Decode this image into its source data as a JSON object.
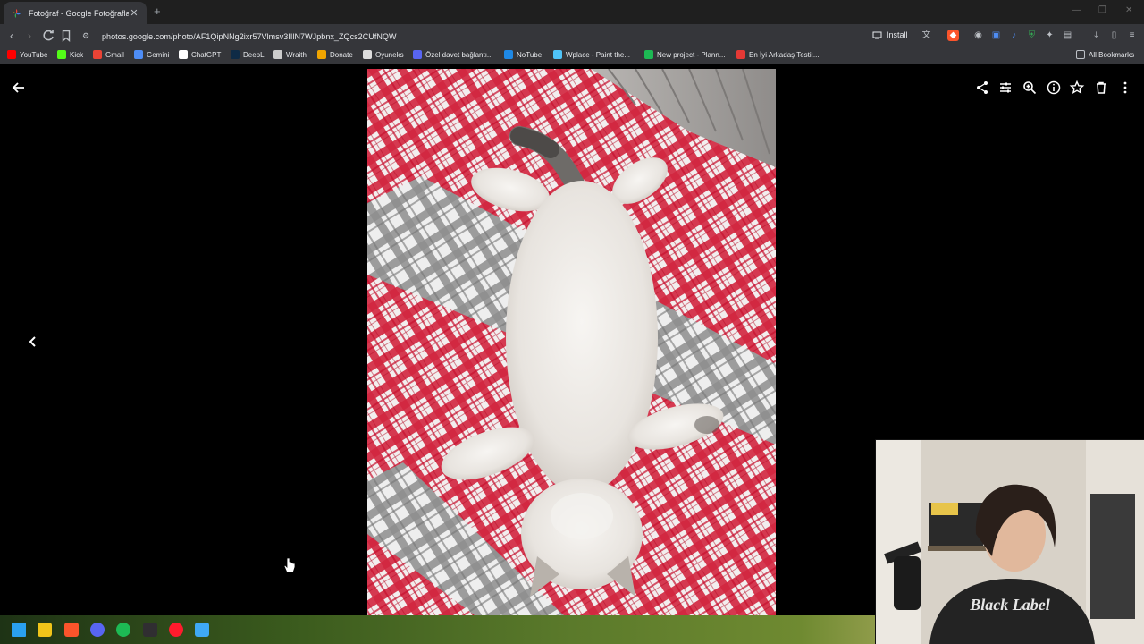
{
  "browser": {
    "tab": {
      "title": "Fotoğraf - Google Fotoğraflar",
      "close_glyph": "✕"
    },
    "new_tab_glyph": "+",
    "url": "photos.google.com/photo/AF1QipNNg2ixr57Vlmsv3IIlN7WJpbnx_ZQcs2CUfNQW",
    "install_label": "Install",
    "bookmarks": [
      {
        "label": "YouTube",
        "icon": "youtube-icon",
        "color": "#ff0000"
      },
      {
        "label": "Kick",
        "icon": "kick-icon",
        "color": "#53fc18"
      },
      {
        "label": "Gmail",
        "icon": "gmail-icon",
        "color": "#ea4335"
      },
      {
        "label": "Gemini",
        "icon": "gemini-icon",
        "color": "#4e8df5"
      },
      {
        "label": "ChatGPT",
        "icon": "chatgpt-icon",
        "color": "#ffffff"
      },
      {
        "label": "DeepL",
        "icon": "deepl-icon",
        "color": "#0f2b46"
      },
      {
        "label": "Wraith",
        "icon": "wraith-icon",
        "color": "#cccccc"
      },
      {
        "label": "Donate",
        "icon": "donate-icon",
        "color": "#f0a500"
      },
      {
        "label": "Oyuneks",
        "icon": "oyuneks-icon",
        "color": "#dddddd"
      },
      {
        "label": "Özel davet bağlantı...",
        "icon": "discord-icon",
        "color": "#5865f2"
      },
      {
        "label": "NoTube",
        "icon": "notube-icon",
        "color": "#1e88e5"
      },
      {
        "label": "Wplace - Paint the...",
        "icon": "wplace-icon",
        "color": "#4fc3f7"
      },
      {
        "label": "New project - Plann...",
        "icon": "planner-icon",
        "color": "#1db954"
      },
      {
        "label": "En İyi Arkadaş Testi:...",
        "icon": "quiz-icon",
        "color": "#e53935"
      }
    ],
    "all_bookmarks_label": "All Bookmarks"
  },
  "viewer": {
    "actions": [
      "share-icon",
      "edit-icon",
      "zoom-icon",
      "info-icon",
      "favorite-icon",
      "delete-icon",
      "more-icon"
    ],
    "back": "back-arrow-icon",
    "prev": "previous-photo-icon"
  },
  "photo": {
    "subject": "white kitten lying on red and grey plaid blanket"
  },
  "taskbar": {
    "apps": [
      {
        "name": "windows-start-icon",
        "color": "#2aa0f0"
      },
      {
        "name": "file-explorer-icon",
        "color": "#f0c419"
      },
      {
        "name": "brave-icon",
        "color": "#fb542b"
      },
      {
        "name": "discord-icon",
        "color": "#5865f2"
      },
      {
        "name": "spotify-icon",
        "color": "#1db954"
      },
      {
        "name": "obs-icon",
        "color": "#302e31"
      },
      {
        "name": "opera-icon",
        "color": "#ff1b2d"
      },
      {
        "name": "app-icon",
        "color": "#3fa9f5"
      }
    ]
  },
  "webcam": {
    "shirt_text": "Black Label"
  }
}
